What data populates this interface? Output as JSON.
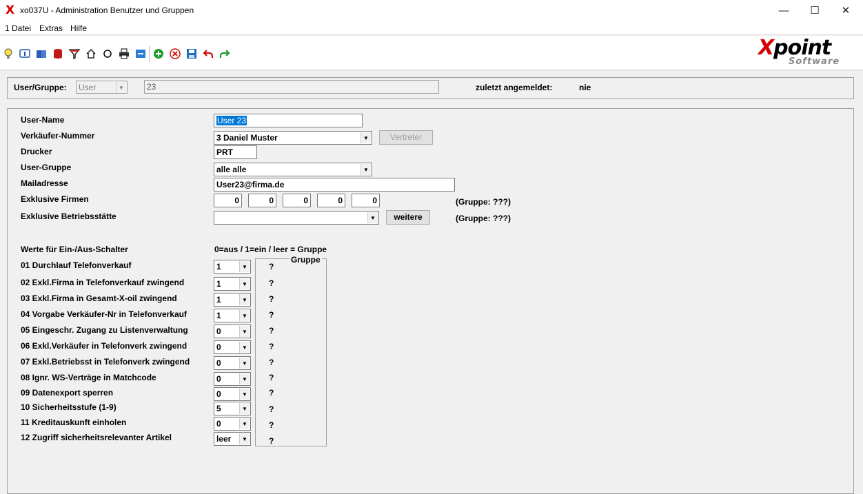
{
  "window": {
    "icon": "X",
    "title": "xo037U - Administration Benutzer und Gruppen",
    "min": "—",
    "max": "☐",
    "close": "✕"
  },
  "menu": [
    "1 Datei",
    "Extras",
    "Hilfe"
  ],
  "toolbar": {
    "icons": [
      "lightbulb-icon",
      "info-icon",
      "book-icon",
      "database-icon",
      "filter-icon",
      "home-icon",
      "refresh-icon",
      "print-icon",
      "message-icon",
      "add-icon",
      "delete-icon",
      "save-icon",
      "undo-icon",
      "redo-icon"
    ]
  },
  "logo": {
    "main_x": "X",
    "main_rest": "point",
    "sub": "Software"
  },
  "top": {
    "label": "User/Gruppe:",
    "type_value": "User",
    "id_value": "23",
    "last_login_label": "zuletzt angemeldet:",
    "last_login_value": "nie"
  },
  "form": {
    "username_label": "User-Name",
    "username_value": "User 23",
    "salesman_label": "Verkäufer-Nummer",
    "salesman_value": "3  Daniel Muster",
    "vertreter_button": "Vertreter",
    "printer_label": "Drucker",
    "printer_value": "PRT",
    "usergroup_label": "User-Gruppe",
    "usergroup_value": "alle  alle",
    "mail_label": "Mailadresse",
    "mail_value": "User23@firma.de",
    "firms_label": "Exklusive Firmen",
    "firms": [
      "0",
      "0",
      "0",
      "0",
      "0"
    ],
    "firms_group": "(Gruppe:  ???)",
    "site_label": "Exklusive Betriebsstätte",
    "site_value": "",
    "weitere_button": "weitere",
    "site_group": "(Gruppe:  ???)"
  },
  "switches": {
    "header_label": "Werte für Ein-/Aus-Schalter",
    "header_legend": "0=aus / 1=ein / leer = Gruppe",
    "group_title": "Gruppe",
    "items": [
      {
        "label": "01 Durchlauf Telefonverkauf",
        "value": "1",
        "group": "?"
      },
      {
        "label": "02 Exkl.Firma in Telefonverkauf zwingend",
        "value": "1",
        "group": "?"
      },
      {
        "label": "03 Exkl.Firma in Gesamt-X-oil zwingend",
        "value": "1",
        "group": "?"
      },
      {
        "label": "04 Vorgabe Verkäufer-Nr in Telefonverkauf",
        "value": "1",
        "group": "?"
      },
      {
        "label": "05 Eingeschr. Zugang zu Listenverwaltung",
        "value": "0",
        "group": "?"
      },
      {
        "label": "06 Exkl.Verkäufer in Telefonverk zwingend",
        "value": "0",
        "group": "?"
      },
      {
        "label": "07 Exkl.Betriebsst in Telefonverk zwingend",
        "value": "0",
        "group": "?"
      },
      {
        "label": "08 Ignr. WS-Verträge in Matchcode",
        "value": "0",
        "group": "?"
      },
      {
        "label": "09 Datenexport sperren",
        "value": "0",
        "group": "?"
      },
      {
        "label": "10 Sicherheitsstufe (1-9)",
        "value": "5",
        "group": "?"
      },
      {
        "label": "11 Kreditauskunft einholen",
        "value": "0",
        "group": "?"
      },
      {
        "label": "12 Zugriff sicherheitsrelevanter Artikel",
        "value": "leer",
        "group": "?"
      }
    ]
  }
}
